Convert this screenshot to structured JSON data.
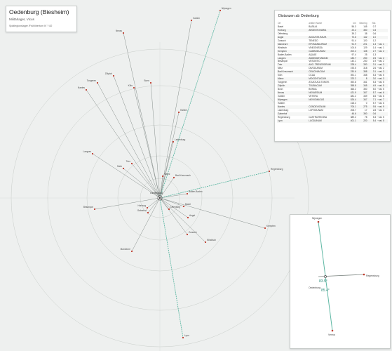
{
  "title": {
    "name": "Oedenburg (Biesheim)",
    "subtitle": "Militärlager, Vicus",
    "meta": "Spätlegionslager /Frühlibertum IV ? 82"
  },
  "table": {
    "heading": "Distanzen ab Oedenburg",
    "columns": [
      "Ort",
      "antiker Name",
      "km",
      "Bearing",
      "Std."
    ],
    "rows": [
      [
        "Basel",
        "BASILIA",
        "56.3",
        "145",
        "0.7",
        ""
      ],
      [
        "Horburg",
        "ARGENTOVARIA",
        "20.2",
        "350",
        "0.3",
        ""
      ],
      [
        "Offenburg",
        "",
        "39.2",
        "38",
        "0.6",
        ""
      ],
      [
        "Augst",
        "AUGUSTA RAUR.",
        "70.6",
        "142",
        "1.0",
        ""
      ],
      [
        "Zurzach",
        "TENEDO",
        "91.4",
        "120",
        "1.2",
        ""
      ],
      [
        "Mandeure",
        "EPOMANDURUM",
        "91.9",
        "221",
        "1.3",
        "~vat. 1"
      ],
      [
        "Windisch",
        "VINDONISSA",
        "104.6",
        "129",
        "1.4",
        "~vat. 1"
      ],
      [
        "Kempten",
        "CAMBODUNUM",
        "202.2",
        "108",
        "2.7",
        "~vat. 2"
      ],
      [
        "Baden-Baden",
        "AQUAE",
        "97.4",
        "25",
        "1.3",
        ""
      ],
      [
        "Langres",
        "ANDEMATUNNUM",
        "183.7",
        "250",
        "2.5",
        "~vat. 2"
      ],
      [
        "Besançon",
        "VESONTIO",
        "140.1",
        "230",
        "1.9",
        "~vat. 2"
      ],
      [
        "Trier",
        "AUG. TREVERORUM",
        "228.4",
        "330",
        "3.1",
        "~vat. 3"
      ],
      [
        "Metz",
        "DIVODURUM",
        "193.5",
        "318",
        "2.6",
        "~vat. 2"
      ],
      [
        "Bad Kreuznach",
        "CRUCINIACUM",
        "230.6",
        "358",
        "3.1",
        "~vat. 3"
      ],
      [
        "Köln",
        "CCAA",
        "391.1",
        "348",
        "5.3",
        "~vat. 5"
      ],
      [
        "Mainz",
        "MOGONTIACUM",
        "223.2",
        "8",
        "3.0",
        "~vat. 3"
      ],
      [
        "Tongeren",
        "ATUATUCA TUNGR.",
        "392.8",
        "341",
        "5.3",
        "~vat. 5"
      ],
      [
        "Zülpich",
        "TOLBIACUM",
        "358.8",
        "345",
        "4.9",
        "~vat. 5"
      ],
      [
        "Bonn",
        "BONNA",
        "366.2",
        "350",
        "5.0",
        "~vat. 5"
      ],
      [
        "Neuss",
        "NOVAESIUM",
        "421.9",
        "347",
        "5.7",
        "~vat. 6"
      ],
      [
        "Xanten",
        "VETERA",
        "481.2",
        "349",
        "6.5",
        "~vat. 6"
      ],
      [
        "Nijmegen",
        "NOVIOMAGUS",
        "526.4",
        "347",
        "7.1",
        "~vat. 7"
      ],
      [
        "Haltern",
        "",
        "418.4",
        "0",
        "5.7",
        "~vat. 6"
      ],
      [
        "Nantes",
        "CONDEVICNUM",
        "706.1",
        "275",
        "9.5",
        "~vat. 9"
      ],
      [
        "Ladenburg",
        "LOPODUNUM",
        "208.7",
        "17",
        "2.8",
        "~vat. 3"
      ],
      [
        "Gaberhof",
        "",
        "46.6",
        "350",
        "0.6",
        ""
      ],
      [
        "Regensburg",
        "CASTRA REGINA",
        "389.2",
        "78",
        "5.3",
        "~vat. 5"
      ],
      [
        "Lyon",
        "LUGDUNUM",
        "401.1",
        "220",
        "5.4",
        "~vat. 5"
      ]
    ]
  },
  "map": {
    "center_label": "Oedenburg",
    "labels": [
      "Mainz",
      "Bad Kreuznach",
      "Trier",
      "Metz",
      "Tongeren",
      "Köln",
      "Bonn",
      "Zülpich",
      "Neuss",
      "Xanten",
      "Nijmegen",
      "Haltern",
      "Ladenburg",
      "Baden-Baden",
      "Offenburg",
      "Horburg",
      "Gaberhof",
      "Basel",
      "Augst",
      "Zurzach",
      "Windisch",
      "Kempten",
      "Regensburg",
      "Mandeure",
      "Besançon",
      "Langres",
      "Nantes",
      "Lyon"
    ],
    "colors": {
      "background": "#eef0ef",
      "ring": "#c9ceca",
      "spoke": "#7c8581",
      "highlight": "#5fb8a4",
      "label": "#4a4a4a",
      "marker": "#c0392b"
    }
  },
  "inset": {
    "labels": [
      "Nijmegen",
      "Oedenburg",
      "Regensburg",
      "Venna"
    ],
    "angle_labels": [
      "83.5°",
      "85.4°"
    ]
  }
}
